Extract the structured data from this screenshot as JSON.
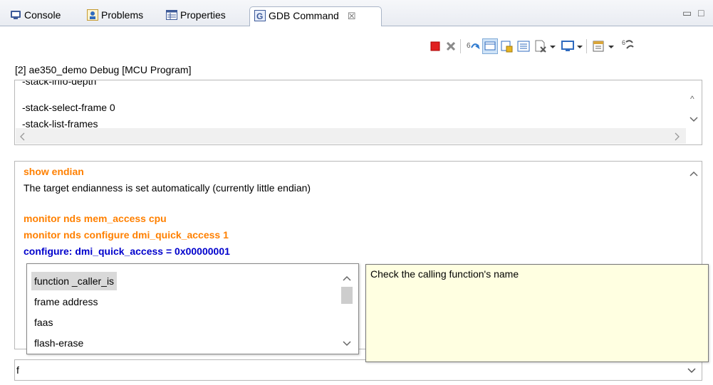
{
  "tabs": [
    {
      "label": "Console",
      "icon": "console-icon"
    },
    {
      "label": "Problems",
      "icon": "problems-icon"
    },
    {
      "label": "Properties",
      "icon": "properties-icon"
    },
    {
      "label": "GDB Command",
      "icon": "gdb-command-icon",
      "active": true,
      "close": "☒"
    }
  ],
  "window_controls": {
    "minimize": "▭",
    "maximize": "□"
  },
  "toolbar": {
    "icons": [
      "terminate-icon",
      "remove-all-icon",
      "connect-icon",
      "display-icon",
      "pin-icon",
      "list-icon",
      "clear-icon",
      "dropdown-icon",
      "display-selected-icon",
      "dropdown-icon",
      "new-console-icon",
      "dropdown-icon",
      "open-console-icon"
    ],
    "colors": {
      "stop": "#e02020",
      "remove": "#8a8a8a"
    }
  },
  "session": {
    "label": "[2] ae350_demo Debug [MCU Program]"
  },
  "history": {
    "lines": [
      "-stack-info-depth",
      "-stack-select-frame 0",
      "-stack-list-frames"
    ]
  },
  "output": {
    "line1": "show endian",
    "line2": "The target endianness is set automatically (currently little endian)",
    "line3": "monitor nds mem_access cpu",
    "line4": "monitor nds configure dmi_quick_access 1",
    "line5": "configure: dmi_quick_access = 0x00000001",
    "colors": {
      "command": "#ff8000",
      "result": "#0000cc"
    }
  },
  "completion": {
    "items": [
      "function _caller_is",
      "frame address",
      "faas",
      "flash-erase"
    ],
    "selected_index": 0
  },
  "tooltip": {
    "text": "Check the calling function's name"
  },
  "input": {
    "value": "f"
  }
}
